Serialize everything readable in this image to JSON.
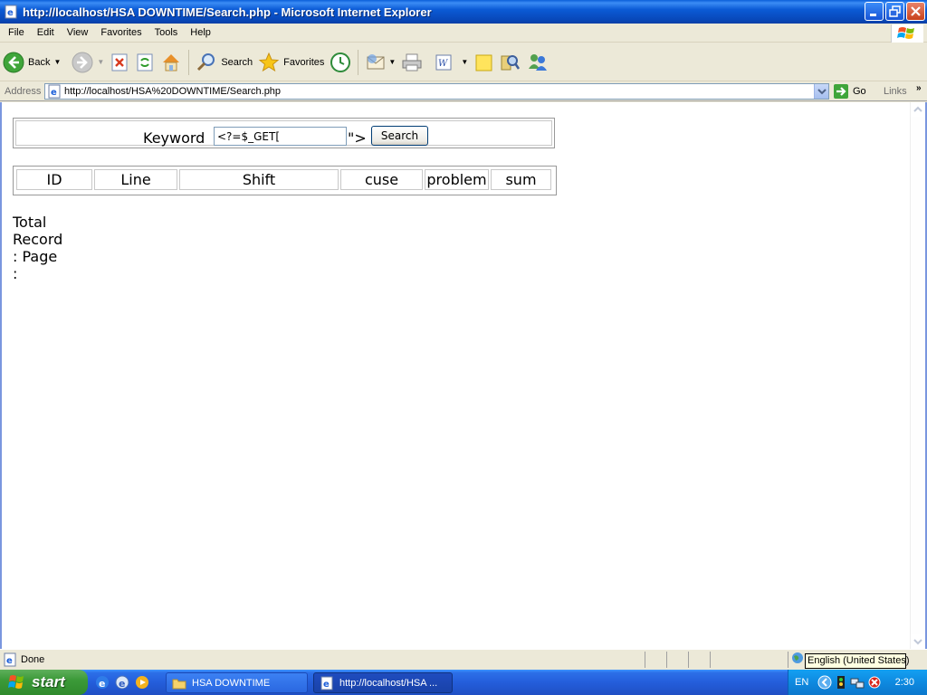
{
  "window": {
    "title": "http://localhost/HSA DOWNTIME/Search.php - Microsoft Internet Explorer"
  },
  "menu": [
    "File",
    "Edit",
    "View",
    "Favorites",
    "Tools",
    "Help"
  ],
  "toolbar": {
    "back_label": "Back",
    "search_label": "Search",
    "favorites_label": "Favorites"
  },
  "address": {
    "label": "Address",
    "url": "http://localhost/HSA%20DOWNTIME/Search.php",
    "go_label": "Go",
    "links_label": "Links"
  },
  "page": {
    "keyword_label": "Keyword",
    "keyword_value": "<?=$_GET[",
    "keyword_tail": "\">",
    "search_button": "Search",
    "columns": [
      "ID",
      "Line",
      "Shift",
      "cuse",
      "problem",
      "sum"
    ],
    "total_text": "Total Record :  Page :"
  },
  "status": {
    "text": "Done",
    "tooltip": "English (United States)"
  },
  "taskbar": {
    "start_label": "start",
    "tasks": [
      "HSA DOWNTIME",
      "http://localhost/HSA ..."
    ],
    "lang": "EN",
    "clock": "2:30"
  },
  "colors": {
    "titlebar": "#0B5BD6",
    "taskbar": "#245EDB",
    "start": "#3C9A39",
    "tray": "#0E8AE0"
  }
}
